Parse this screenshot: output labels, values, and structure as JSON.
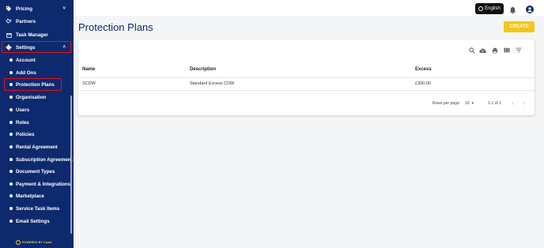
{
  "sidebar": {
    "items": [
      {
        "label": "Pricing",
        "icon": "tag-icon",
        "chevron": "˅"
      },
      {
        "label": "Partners",
        "icon": "handshake-icon"
      },
      {
        "label": "Task Manager",
        "icon": "calendar-icon"
      },
      {
        "label": "Settings",
        "icon": "gear-icon",
        "chevron": "˄"
      }
    ],
    "sub_items": [
      "Account",
      "Add Ons",
      "Protection Plans",
      "Organisation",
      "Users",
      "Roles",
      "Policies",
      "Rental Agreement",
      "Subscription Agreement",
      "Document Types",
      "Payment & Integrations",
      "Marketplace",
      "Service Task Items",
      "Email Settings"
    ],
    "powered_by": "POWERED BY Coast"
  },
  "topbar": {
    "language": "English"
  },
  "main": {
    "title": "Protection Plans",
    "create_label": "CREATE",
    "table": {
      "columns": [
        "Name",
        "Description",
        "Excess"
      ],
      "rows": [
        [
          "SCDW",
          "Standard Excess CDW",
          "£300.00"
        ]
      ]
    },
    "footer": {
      "rows_per_page_label": "Rows per page:",
      "rows_per_page_value": "10",
      "range": "1-1 of 1"
    }
  },
  "colors": {
    "sidebar_bg": "#0d2a6e",
    "accent": "#f5c518",
    "highlight": "#e0101e",
    "title": "#0d2a6e"
  }
}
